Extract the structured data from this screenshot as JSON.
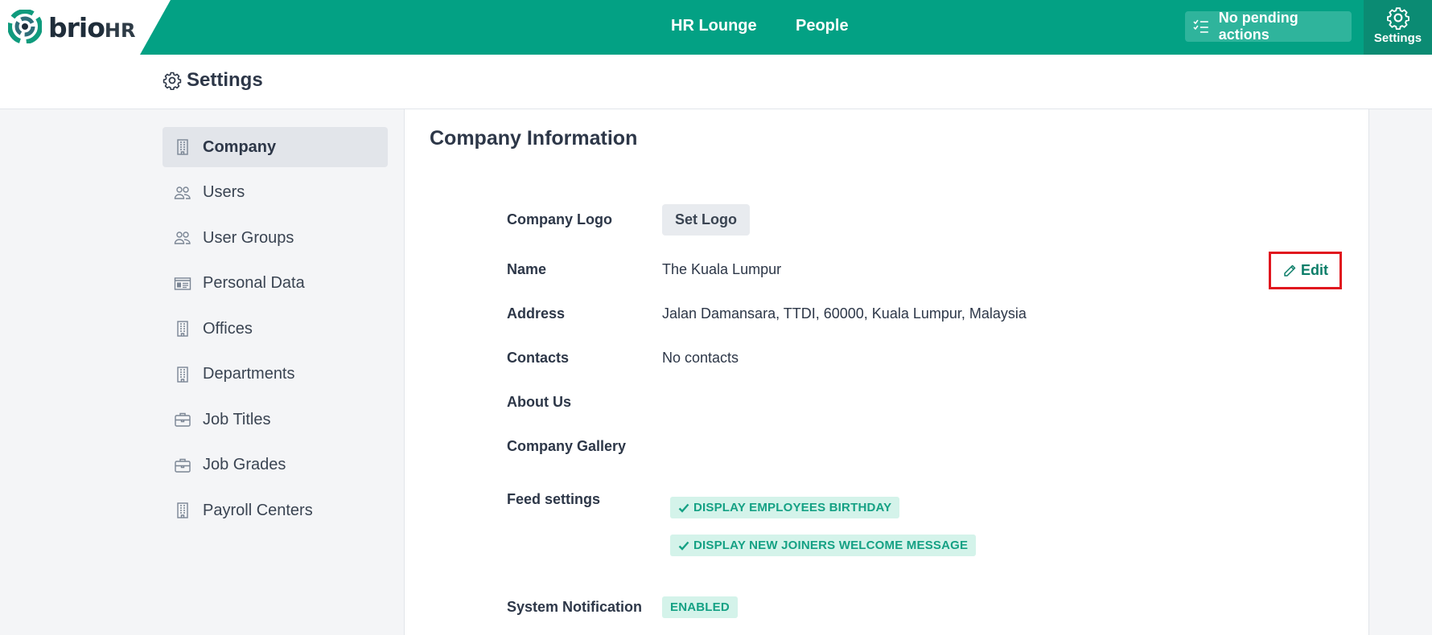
{
  "brand": {
    "name": "brio",
    "suffix": "HR",
    "colors": {
      "primary": "#03a184",
      "dark": "#0b8b73",
      "accent_red": "#e0161e"
    }
  },
  "topnav": {
    "links": [
      {
        "label": "HR Lounge"
      },
      {
        "label": "People"
      }
    ],
    "pending_label": "No pending actions",
    "settings_label": "Settings"
  },
  "page": {
    "title": "Settings"
  },
  "sidebar": {
    "items": [
      {
        "label": "Company",
        "icon": "building-icon",
        "active": true
      },
      {
        "label": "Users",
        "icon": "users-icon"
      },
      {
        "label": "User Groups",
        "icon": "users-icon"
      },
      {
        "label": "Personal Data",
        "icon": "id-card-icon"
      },
      {
        "label": "Offices",
        "icon": "building-icon"
      },
      {
        "label": "Departments",
        "icon": "building-icon"
      },
      {
        "label": "Job Titles",
        "icon": "briefcase-icon"
      },
      {
        "label": "Job Grades",
        "icon": "briefcase-icon"
      },
      {
        "label": "Payroll Centers",
        "icon": "building-icon"
      }
    ]
  },
  "company": {
    "section_title": "Company Information",
    "edit_label": "Edit",
    "logo": {
      "label": "Company Logo",
      "button": "Set Logo"
    },
    "name": {
      "label": "Name",
      "value": "The Kuala Lumpur"
    },
    "address": {
      "label": "Address",
      "value": "Jalan Damansara, TTDI, 60000, Kuala Lumpur, Malaysia"
    },
    "contacts": {
      "label": "Contacts",
      "value": "No contacts"
    },
    "about": {
      "label": "About Us"
    },
    "gallery": {
      "label": "Company Gallery"
    },
    "feed": {
      "label": "Feed settings",
      "tags": [
        "DISPLAY EMPLOYEES BIRTHDAY",
        "DISPLAY NEW JOINERS WELCOME MESSAGE"
      ]
    },
    "notification": {
      "label": "System Notification",
      "value": "ENABLED"
    }
  }
}
